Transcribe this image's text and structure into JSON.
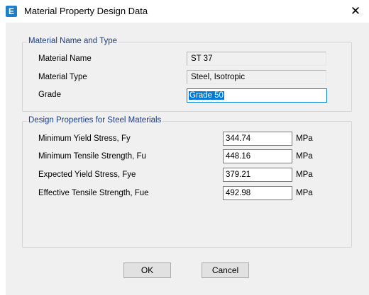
{
  "window": {
    "title": "Material Property Design Data",
    "app_icon_letter": "E",
    "close_glyph": "✕"
  },
  "material_group": {
    "title": "Material Name and Type",
    "name_label": "Material Name",
    "name_value": "ST 37",
    "type_label": "Material Type",
    "type_value": "Steel, Isotropic",
    "grade_label": "Grade",
    "grade_value": "Grade 50"
  },
  "design_group": {
    "title": "Design Properties for Steel Materials",
    "rows": [
      {
        "label": "Minimum Yield Stress, Fy",
        "value": "344.74",
        "unit": "MPa"
      },
      {
        "label": "Minimum Tensile Strength, Fu",
        "value": "448.16",
        "unit": "MPa"
      },
      {
        "label": "Expected Yield Stress, Fye",
        "value": "379.21",
        "unit": "MPa"
      },
      {
        "label": "Effective Tensile Strength, Fue",
        "value": "492.98",
        "unit": "MPa"
      }
    ]
  },
  "buttons": {
    "ok": "OK",
    "cancel": "Cancel"
  },
  "colors": {
    "group_title": "#1a3b8a",
    "selection": "#0078d7",
    "app_icon": "#1e7ec8"
  }
}
